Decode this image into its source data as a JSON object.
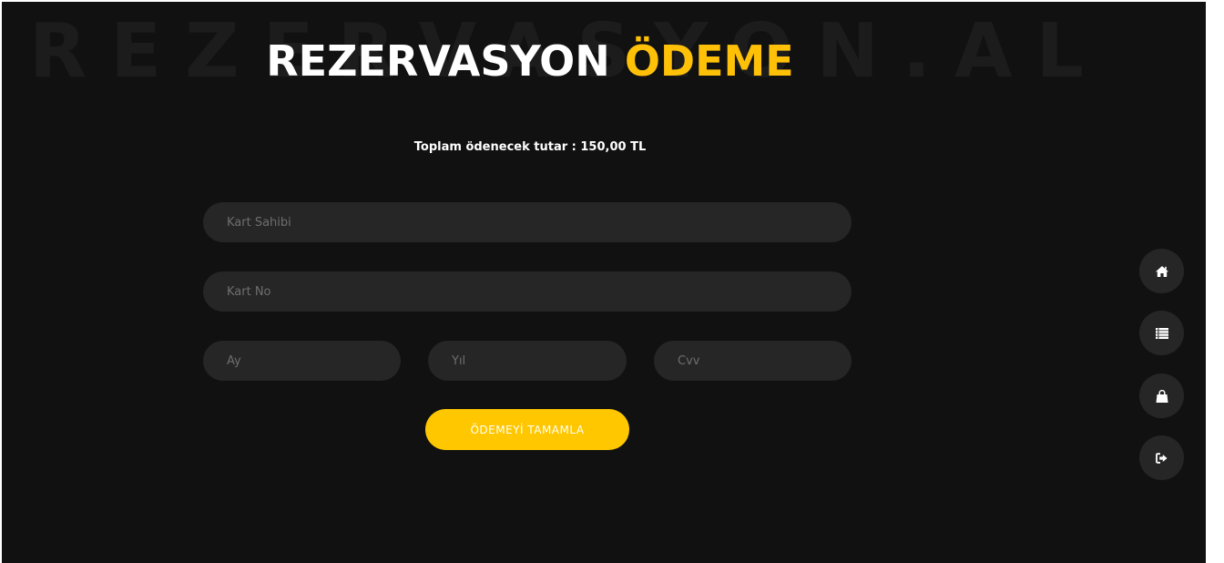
{
  "header": {
    "watermark": "REZERVASYON.AL",
    "title_white": "REZERVASYON",
    "title_yellow": "ÖDEME"
  },
  "summary": {
    "total_text": "Toplam ödenecek tutar : 150,00 TL"
  },
  "form": {
    "card_holder_placeholder": "Kart Sahibi",
    "card_number_placeholder": "Kart No",
    "month_placeholder": "Ay",
    "year_placeholder": "Yıl",
    "cvv_placeholder": "Cvv",
    "submit_label": "ÖDEMEYİ TAMAMLA"
  },
  "side_nav": {
    "items": [
      {
        "icon": "home-icon"
      },
      {
        "icon": "list-icon"
      },
      {
        "icon": "shopping-bag-icon"
      },
      {
        "icon": "sign-out-icon"
      }
    ]
  },
  "colors": {
    "background": "#111111",
    "accent": "#ffc700",
    "field_background": "#262626",
    "watermark": "#1c1c1c"
  }
}
